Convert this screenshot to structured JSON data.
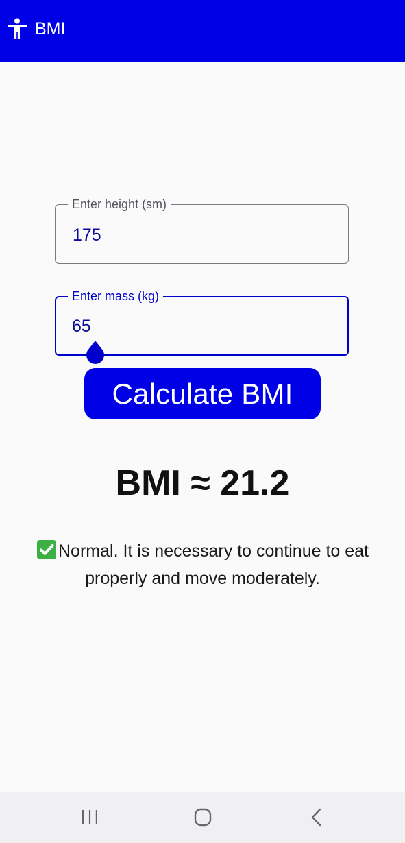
{
  "app_bar": {
    "title": "BMI",
    "icon": "accessibility-person-icon",
    "color": "#0000e6"
  },
  "form": {
    "height_field": {
      "label": "Enter height (sm)",
      "value": "175"
    },
    "mass_field": {
      "label": "Enter mass (kg)",
      "value": "65"
    },
    "calculate_label": "Calculate BMI"
  },
  "result": {
    "bmi_text": "BMI ≈ 21.2",
    "advice_icon": "check-mark-icon",
    "advice_text": "Normal. It is necessary to continue to eat properly and move moderately."
  },
  "nav": {
    "recents_icon": "recents-icon",
    "home_icon": "home-icon",
    "back_icon": "back-icon"
  },
  "colors": {
    "accent": "#0000e6",
    "focused_border": "#0000cc",
    "check": "#3cb043"
  }
}
